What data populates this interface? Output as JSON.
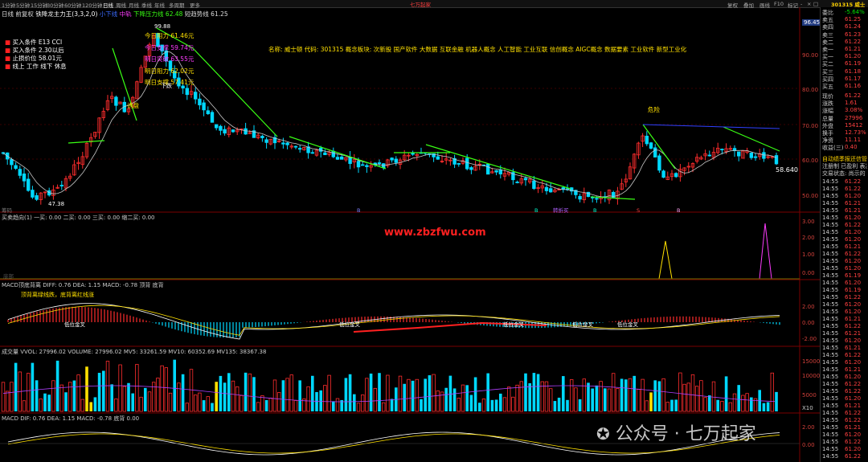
{
  "title_bar": {
    "period_tabs": [
      "1分钟",
      "5分钟",
      "15分钟",
      "30分钟",
      "60分钟",
      "120分钟",
      "日线",
      "周线",
      "月线",
      "季线",
      "年线",
      "多周期",
      "更多"
    ],
    "center_title": "七万起家",
    "right_buttons": [
      "复权",
      "叠加",
      "画线",
      "F10",
      "标记",
      "-",
      "×",
      "□"
    ],
    "stock_code_name": "301315 威士"
  },
  "main_panel": {
    "header": {
      "period_label": "日线",
      "adjust_label": "前复权",
      "indicator_name": "铁降龙主力王(3,3,2,0)",
      "indicator_value": "小下线",
      "item_mid": "中轨",
      "item_pressure": "下降压力线 62.48",
      "item_short": "短趋势线 61.25"
    },
    "left_notes": [
      "买入条件 E13 CCI",
      "买入条件 2.30以后",
      "止损价位 58.01元",
      "线上 工作 线下 休息"
    ],
    "resistance_labels": [
      "今日阻力  61.46元",
      "今日支撑  59.74元",
      "明日突破  63.55元",
      "明日阻力  62.02元",
      "明日支撑  57.41元"
    ],
    "peak_price": "99.88",
    "low_price": "47.38",
    "last_price": "58.640",
    "current_price_tag": "96.45",
    "annotation_one": "诱盘",
    "annotation_two": "危险",
    "annotation_three": "下跌",
    "concept_text": "名称: 威士顿 代码: 301315 概念板块: 次新股 国产软件 大数据 互联金融 机器人概念 人工智能 工业互联 信创概念 AIGC概念 数据要素 工业软件 新型工业化",
    "bottom_tags": [
      "B",
      "B",
      "转折买",
      "B",
      "S",
      "B"
    ],
    "label_chip": "筹码"
  },
  "price_axis": [
    "80.00",
    "70.00",
    "60.00",
    "50.00",
    "90.00"
  ],
  "panel2": {
    "header": "买卖趋向(1) 一买: 0.00 二买: 0.00 三买: 0.00 缩二买: 0.00",
    "watermark": "www.zbzfwu.com",
    "axis": [
      "3.00",
      "2.00",
      "1.00",
      "0.00"
    ],
    "side_label": "底部"
  },
  "panel3": {
    "header": "MACD顶底背离 DIFF: 0.76 DEA: 1.15 MACD: -0.78 顶背 底背",
    "note": "顶背离绿线跌，底背离红线涨",
    "cross_labels": [
      "低位金叉",
      "低位金叉",
      "低位金叉",
      "低位金叉",
      "低位金叉",
      "低位金叉"
    ],
    "axis": [
      "2.00",
      "0.00",
      "-2.00"
    ]
  },
  "panel4": {
    "header": "成交量 VVOL: 27996.02 VOLUME: 27996.02 MV5: 33261.59 MV10: 60352.69 MV135: 38367.38",
    "axis": [
      "15000",
      "10000",
      "5000"
    ],
    "unit": "X10"
  },
  "panel5": {
    "header": "MACD DIF: 0.76 DEA: 1.15 MACD: -0.78 底背 0.00",
    "axis": [
      "2.00",
      "0.00"
    ]
  },
  "side_panel": {
    "stats": [
      {
        "label": "委比",
        "value": "-5.64%"
      },
      {
        "label": "卖五",
        "value": "61.25"
      },
      {
        "label": "卖四",
        "value": "61.24"
      },
      {
        "label": "卖三",
        "value": "61.23"
      },
      {
        "label": "卖二",
        "value": "61.22"
      },
      {
        "label": "卖一",
        "value": "61.21"
      },
      {
        "label": "买一",
        "value": "61.20"
      },
      {
        "label": "买二",
        "value": "61.19"
      },
      {
        "label": "买三",
        "value": "61.18"
      },
      {
        "label": "买四",
        "value": "61.17"
      },
      {
        "label": "买五",
        "value": "61.16"
      },
      {
        "label": "现价",
        "value": "61.22"
      },
      {
        "label": "涨跌",
        "value": "1.61"
      },
      {
        "label": "涨幅",
        "value": "3.08%"
      },
      {
        "label": "总量",
        "value": "27996"
      },
      {
        "label": "外盘",
        "value": "15412"
      },
      {
        "label": "换手",
        "value": "12.73%"
      },
      {
        "label": "净资",
        "value": "11.11"
      },
      {
        "label": "收益(三)",
        "value": "0.40"
      }
    ],
    "notice": [
      "自动绩季报还信管",
      "注册制 已盈利 表决",
      "交易状态: 尚示的"
    ],
    "ticks_time": [
      "14:55",
      "14:55",
      "14:55",
      "14:55",
      "14:55",
      "14:55",
      "14:55",
      "14:55",
      "14:55",
      "14:55",
      "14:55",
      "14:55",
      "14:55",
      "14:55",
      "14:55",
      "14:55",
      "14:55",
      "14:55",
      "14:55",
      "14:55",
      "14:55",
      "14:55",
      "14:55",
      "14:55",
      "14:55",
      "14:55",
      "14:55",
      "14:55",
      "14:55",
      "14:55",
      "14:55",
      "14:55",
      "14:55",
      "14:55",
      "14:55",
      "14:55",
      "14:55",
      "14:55",
      "14:55",
      "14:55"
    ],
    "ticks_price": [
      "61.22",
      "61.22",
      "61.20",
      "61.21",
      "61.21",
      "61.20",
      "61.22",
      "61.20",
      "61.20",
      "61.21",
      "61.22",
      "61.20",
      "61.20",
      "61.19",
      "61.20",
      "61.19",
      "61.22",
      "61.20",
      "61.20",
      "61.21",
      "61.22",
      "61.21",
      "61.20",
      "61.21",
      "61.22",
      "61.20",
      "61.21",
      "61.20",
      "61.22",
      "61.22",
      "61.20",
      "61.21",
      "61.22",
      "61.22",
      "61.21",
      "61.20",
      "61.22",
      "61.20",
      "61.22",
      "61.22"
    ]
  },
  "footer_watermark": "公众号 · 七万起家",
  "colors": {
    "up": "#ff2d2d",
    "down": "#00d8ff",
    "ma": "#c8c8c8",
    "trend": "#39ff14",
    "purple": "#b040ff",
    "yellow": "#ffe000",
    "magenta": "#ff3cff"
  }
}
